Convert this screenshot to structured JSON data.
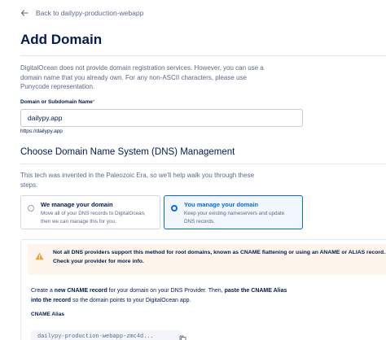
{
  "nav": {
    "back_label": "Back to dailypy-production-webapp"
  },
  "page": {
    "title": "Add Domain",
    "intro": "DigitalOcean does not provide domain registration services. However, you can use a domain name that you already own. For any non-ASCII characters, please use Punycode representation."
  },
  "domain_field": {
    "label": "Domain or Subdomain Name",
    "required_mark": "*",
    "value": "dailypy.app",
    "hint": "https://dailypy.app"
  },
  "dns": {
    "title": "Choose Domain Name System (DNS) Management",
    "description": "This tech was invented in the Paleozoic Era, so we'll help walk you through these steps.",
    "options": [
      {
        "title": "We manage your domain",
        "desc": "Move all of your DNS records to DigitalOcean, then we can manage this for you.",
        "selected": false
      },
      {
        "title": "You manage your domain",
        "desc": "Keep your existing nameservers and update DNS records.",
        "selected": true
      }
    ]
  },
  "provider": {
    "warning": "Not all DNS providers support this method for root domains, known as CNAME flattening or using an ANAME or ALIAS record. Check your provider for more info.",
    "instr_1": "Create a ",
    "instr_bold_1": "new CNAME record",
    "instr_2": " for your domain on your DNS Provider. Then, ",
    "instr_bold_2": "paste the CNAME Alias into the record",
    "instr_3": " so the domain points to your DigitalOcean app.",
    "alias_label": "CNAME Alias",
    "alias_value": "dailypy-production-webapp-zmc4d..."
  },
  "colors": {
    "accent": "#0069ff",
    "title": "#031b4e",
    "muted": "#5b6987",
    "warning_bg": "#fef6ec",
    "warning_icon": "#f0a23b"
  }
}
